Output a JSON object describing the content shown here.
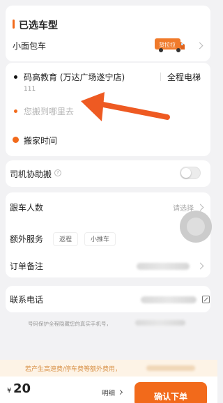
{
  "vehicle": {
    "section_title": "已选车型",
    "type_label": "小面包车",
    "van_badge_text": "货拉拉"
  },
  "address": {
    "origin_name": "码高教育 (万达广场遂宁店)",
    "origin_service": "全程电梯",
    "origin_detail": "111",
    "destination_placeholder": "您搬到哪里去",
    "move_time_label": "搬家时间"
  },
  "driver_help": {
    "label": "司机协助搬",
    "info_icon": "question-circle-icon",
    "enabled": false
  },
  "follow": {
    "label": "跟车人数",
    "placeholder": "请选择"
  },
  "extras": {
    "label": "额外服务",
    "chips": [
      "返程",
      "小推车"
    ]
  },
  "remarks": {
    "label": "订单备注"
  },
  "contact": {
    "label": "联系电话",
    "edit_icon": "edit-icon",
    "privacy_note": "号码保护全程隐藏您的真实手机号，"
  },
  "notice": {
    "text": "若产生高速费/停车费等额外费用，"
  },
  "footer": {
    "currency": "¥",
    "price": "20",
    "detail_label": "明细",
    "confirm_label": "确认下单"
  },
  "colors": {
    "accent": "#f26a1b",
    "arrow": "#ee5a22",
    "notice_bg": "#fdf3e6",
    "notice_text": "#d9934a"
  }
}
